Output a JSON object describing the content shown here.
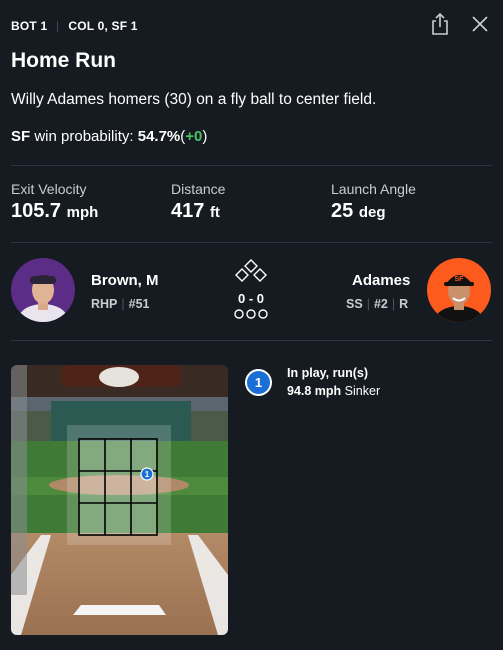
{
  "header": {
    "inning": "BOT 1",
    "score": "COL 0, SF 1"
  },
  "play": {
    "title": "Home Run",
    "description": "Willy Adames homers (30) on a fly ball to center field.",
    "win_prob_team": "SF",
    "win_prob_label": "win probability:",
    "win_prob_value": "54.7%",
    "win_prob_open": "(",
    "win_prob_delta": "+0",
    "win_prob_close": ")"
  },
  "stats": [
    {
      "label": "Exit Velocity",
      "value": "105.7",
      "unit": "mph"
    },
    {
      "label": "Distance",
      "value": "417",
      "unit": "ft"
    },
    {
      "label": "Launch Angle",
      "value": "25",
      "unit": "deg"
    }
  ],
  "pitcher": {
    "name": "Brown, M",
    "hand": "RHP",
    "number": "#51",
    "color": "#5b2d86"
  },
  "batter": {
    "name": "Adames",
    "position": "SS",
    "number": "#2",
    "bats": "R",
    "color": "#fd5a1e"
  },
  "count": "0 - 0",
  "pitch": {
    "index": "1",
    "result": "In play, run(s)",
    "speed": "94.8 mph",
    "type": "Sinker"
  },
  "icons": {
    "share": "share-icon",
    "close": "close-icon",
    "bases": "bases-icon",
    "outs": "outs-icon"
  },
  "colors": {
    "background": "#151b21",
    "accent": "#1a6fd6",
    "positive": "#4cc164"
  }
}
